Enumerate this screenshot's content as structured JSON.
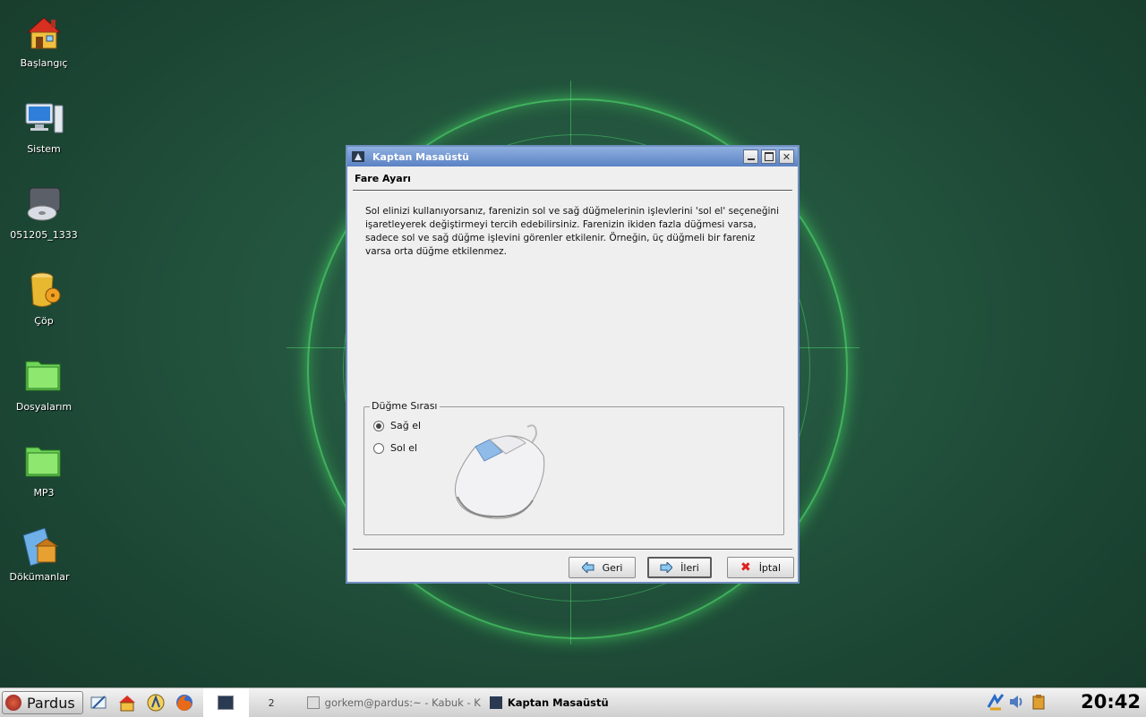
{
  "desktop": {
    "icons": [
      {
        "label": "Başlangıç",
        "icon": "home-icon"
      },
      {
        "label": "Sistem",
        "icon": "computer-icon"
      },
      {
        "label": "051205_1333",
        "icon": "disk-icon"
      },
      {
        "label": "Çöp",
        "icon": "trash-icon"
      },
      {
        "label": "Dosyalarım",
        "icon": "folder-icon"
      },
      {
        "label": "MP3",
        "icon": "folder-icon"
      },
      {
        "label": "Dökümanlar",
        "icon": "documents-icon"
      }
    ]
  },
  "window": {
    "title": "Kaptan Masaüstü",
    "page_title": "Fare Ayarı",
    "description": "Sol elinizi kullanıyorsanız, farenizin sol ve sağ düğmelerinin işlevlerini 'sol el' seçeneğini işaretleyerek değiştirmeyi tercih edebilirsiniz. Farenizin ikiden fazla düğmesi varsa, sadece sol ve sağ düğme işlevini görenler etkilenir. Örneğin, üç düğmeli bir fareniz varsa orta düğme etkilenmez.",
    "group_title": "Düğme Sırası",
    "options": [
      {
        "label": "Sağ el",
        "checked": true
      },
      {
        "label": "Sol el",
        "checked": false
      }
    ],
    "buttons": {
      "back": "Geri",
      "next": "İleri",
      "cancel": "İptal"
    }
  },
  "taskbar": {
    "start_label": "Pardus",
    "pager": [
      "",
      "2"
    ],
    "tasks": [
      {
        "label": "gorkem@pardus:~ - Kabuk - K",
        "active": false
      },
      {
        "label": "Kaptan Masaüstü",
        "active": true
      }
    ],
    "clock": "20:42"
  },
  "colors": {
    "desktop_bg": "#24563f",
    "titlebar": "#5a82c4",
    "radar_glow": "#5aff78"
  }
}
